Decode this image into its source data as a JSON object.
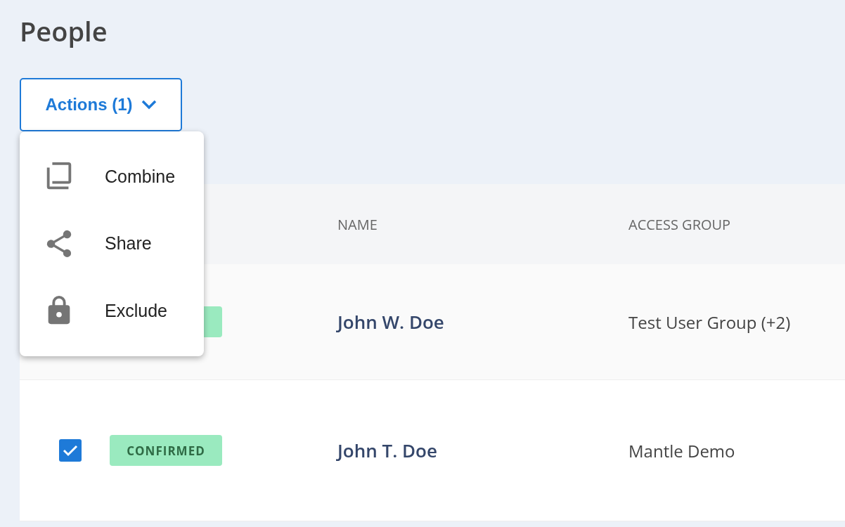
{
  "page": {
    "title": "People"
  },
  "actions_button": {
    "label": "Actions (1)",
    "expanded": true
  },
  "actions_menu": [
    {
      "label": "Combine"
    },
    {
      "label": "Share"
    },
    {
      "label": "Exclude"
    }
  ],
  "table": {
    "columns": [
      "NAME",
      "ACCESS GROUP"
    ],
    "rows": [
      {
        "badge": {
          "color": "#9aeabf"
        },
        "name": "John W. Doe",
        "access_group": "Test User Group (+2)"
      },
      {
        "checked": true,
        "badge": {
          "label": "CONFIRMED",
          "color": "#9aeabf"
        },
        "name": "John T. Doe",
        "access_group": "Mantle Demo"
      }
    ]
  }
}
